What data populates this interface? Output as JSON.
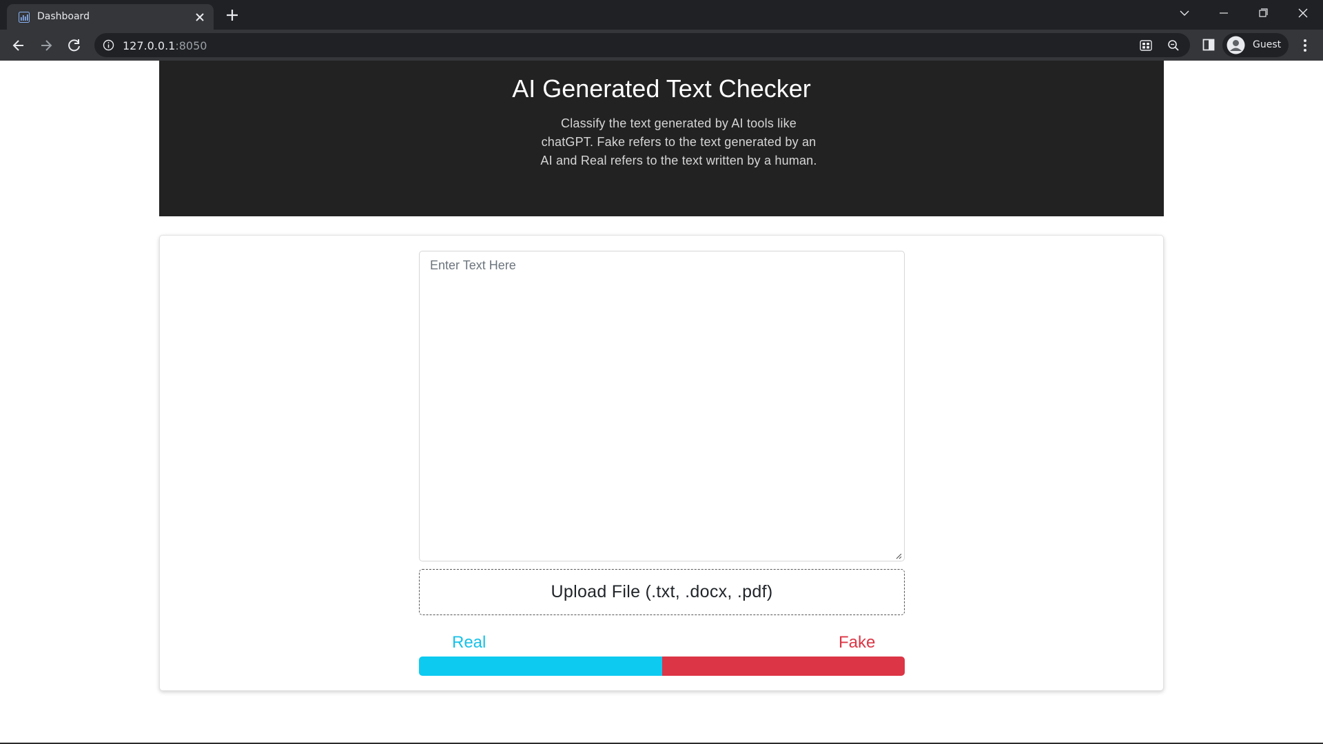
{
  "browser": {
    "tab_title": "Dashboard",
    "url_host": "127.0.0.1",
    "url_port": ":8050",
    "profile_name": "Guest",
    "icons": [
      "bar-chart-favicon-icon",
      "close-icon",
      "plus-icon",
      "chevron-down-icon",
      "minimize-icon",
      "restore-icon",
      "window-close-icon",
      "back-arrow-icon",
      "forward-arrow-icon",
      "reload-icon",
      "info-icon",
      "install-app-icon",
      "zoom-icon",
      "side-panel-icon",
      "avatar-icon",
      "kebab-menu-icon"
    ]
  },
  "header": {
    "title": "AI Generated Text Checker",
    "description": "Classify the text generated by AI tools like chatGPT. Fake refers to the text generated by an AI and Real refers to the text written by a human."
  },
  "form": {
    "text_placeholder": "Enter Text Here",
    "text_value": "",
    "upload_label": "Upload File (.txt, .docx, .pdf)"
  },
  "result": {
    "real_label": "Real",
    "fake_label": "Fake",
    "real_fraction": 0.5,
    "fake_fraction": 0.5,
    "real_color": "#0dcaf0",
    "fake_color": "#dc3545",
    "real_text_color": "#17c1e8",
    "fake_text_color": "#dc3545"
  },
  "colors": {
    "header_bg": "#222222",
    "page_bg": "#ffffff",
    "chrome_dark": "#202124",
    "chrome_toolbar": "#35363a"
  }
}
